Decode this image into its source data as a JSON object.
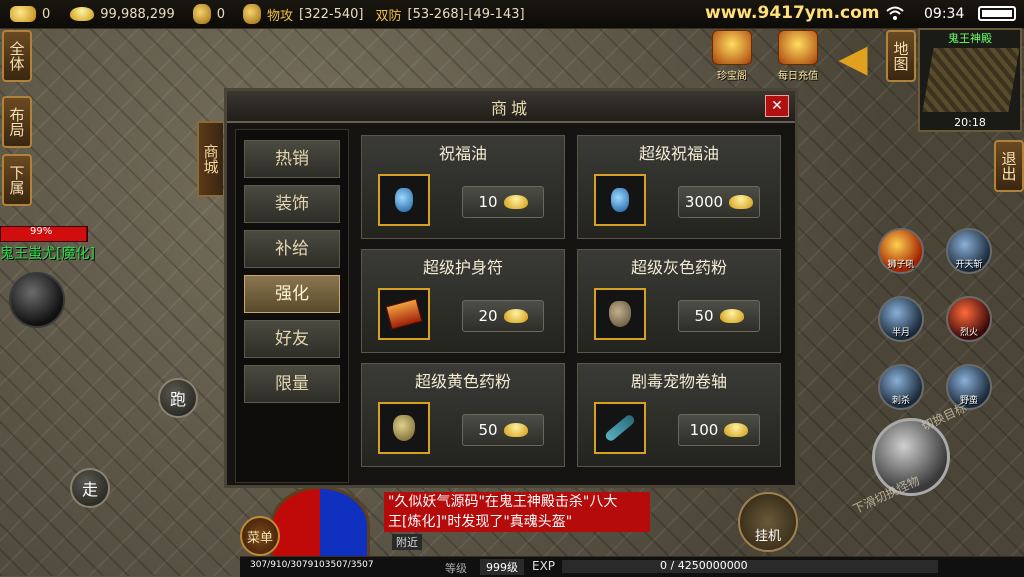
{
  "topbar": {
    "gold_count": "0",
    "ingot_count": "99,988,299",
    "bag_count": "0",
    "phys_atk_label": "物攻",
    "phys_atk_value": "[322-540]",
    "def_label": "双防",
    "def_value": "[53-268]-[49-143]",
    "site": "www.9417ym.com",
    "time": "09:34"
  },
  "left": {
    "btn_all": "全体",
    "btn_layout": "布局",
    "btn_sub": "下属",
    "boss_hp": "99%",
    "boss_hp_fraction": 0.99,
    "boss_name": "鬼王蚩尤[魔化]",
    "run": "跑",
    "walk": "走"
  },
  "right": {
    "treasure": "珍宝阁",
    "daily_recharge": "每日充值",
    "map_btn": "地图",
    "minimap_title": "鬼王神殿",
    "minimap_time": "20:18",
    "exit_btn": "退出",
    "skills": [
      "狮子吼",
      "开天斩",
      "半月",
      "烈火",
      "刺杀",
      "野蛮"
    ],
    "switch_target": "切换目标",
    "switch_monster": "下滑切换怪物"
  },
  "shop": {
    "title": "商城",
    "close": "✕",
    "side_tab": "商城",
    "categories": [
      "热销",
      "装饰",
      "补给",
      "强化",
      "好友",
      "限量"
    ],
    "active_category": "强化",
    "items": [
      {
        "name": "祝福油",
        "price": "10",
        "icon": "blue-bottle"
      },
      {
        "name": "超级祝福油",
        "price": "3000",
        "icon": "blue-bottle"
      },
      {
        "name": "超级护身符",
        "price": "20",
        "icon": "amulet-book"
      },
      {
        "name": "超级灰色药粉",
        "price": "50",
        "icon": "grey-powder-pouch"
      },
      {
        "name": "超级黄色药粉",
        "price": "50",
        "icon": "yellow-powder-pouch"
      },
      {
        "name": "剧毒宠物卷轴",
        "price": "100",
        "icon": "scroll"
      }
    ]
  },
  "bottom": {
    "menu": "菜单",
    "hpmp": "307/910/3079103507/3507",
    "chat_line1": "\"久似妖气源码\"在鬼王神殿击杀\"八大",
    "chat_line2": "王[炼化]\"时发现了\"真魂头盔\"",
    "nearby": "附近",
    "level_label": "等级",
    "level_value": "999级",
    "exp_label": "EXP",
    "exp_value": "0 / 4250000000",
    "exp_fraction": 0,
    "hangup": "挂机"
  }
}
